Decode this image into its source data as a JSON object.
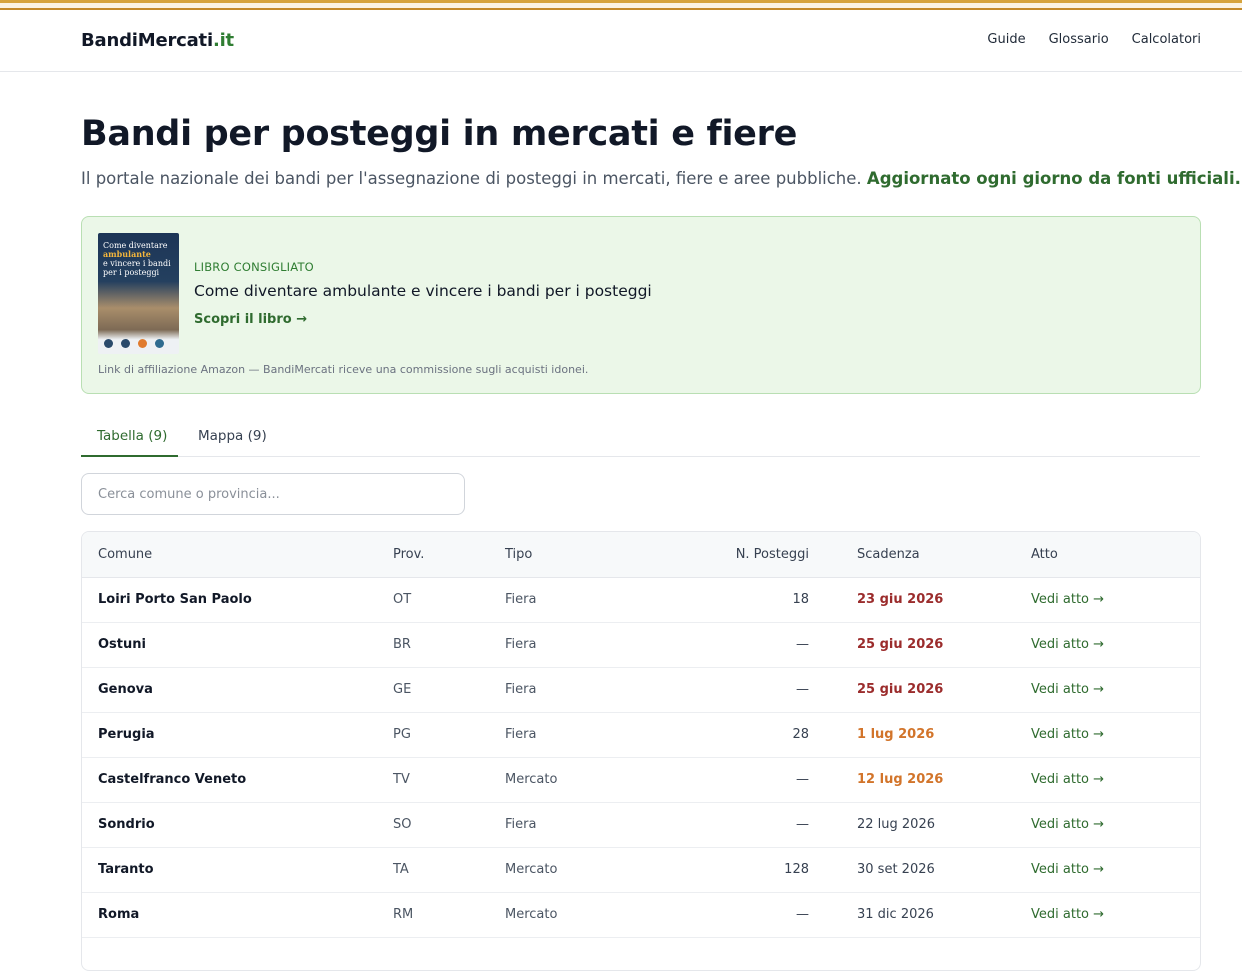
{
  "header": {
    "logo_name": "BandiMercati",
    "logo_tld": ".it",
    "nav": [
      "Guide",
      "Glossario",
      "Calcolatori"
    ]
  },
  "hero": {
    "title": "Bandi per posteggi in mercati e fiere",
    "subtitle": "Il portale nazionale dei bandi per l'assegnazione di posteggi in mercati, fiere e aree pubbliche.",
    "subtitle_highlight": "Aggiornato ogni giorno da fonti ufficiali."
  },
  "promo": {
    "cover_line1": "Come diventare",
    "cover_line2": "ambulante",
    "cover_line3": "e vincere i bandi",
    "cover_line4": "per i posteggi",
    "kicker": "LIBRO CONSIGLIATO",
    "title": "Come diventare ambulante e vincere i bandi per i posteggi",
    "link": "Scopri il libro →",
    "note": "Link di affiliazione Amazon — BandiMercati riceve una commissione sugli acquisti idonei."
  },
  "tabs": [
    {
      "label": "Tabella (9)",
      "active": true
    },
    {
      "label": "Mappa (9)",
      "active": false
    }
  ],
  "search": {
    "placeholder": "Cerca comune o provincia...",
    "value": ""
  },
  "table": {
    "headers": [
      "Comune",
      "Prov.",
      "Tipo",
      "N. Posteggi",
      "Scadenza",
      "Atto"
    ],
    "rows": [
      {
        "comune": "Loiri Porto San Paolo",
        "prov": "OT",
        "tipo": "Fiera",
        "posteggi": "18",
        "scadenza": "23 giu 2026",
        "urgency": "red",
        "atto": "Vedi atto →"
      },
      {
        "comune": "Ostuni",
        "prov": "BR",
        "tipo": "Fiera",
        "posteggi": "—",
        "scadenza": "25 giu 2026",
        "urgency": "red",
        "atto": "Vedi atto →"
      },
      {
        "comune": "Genova",
        "prov": "GE",
        "tipo": "Fiera",
        "posteggi": "—",
        "scadenza": "25 giu 2026",
        "urgency": "red",
        "atto": "Vedi atto →"
      },
      {
        "comune": "Perugia",
        "prov": "PG",
        "tipo": "Fiera",
        "posteggi": "28",
        "scadenza": "1 lug 2026",
        "urgency": "orange",
        "atto": "Vedi atto →"
      },
      {
        "comune": "Castelfranco Veneto",
        "prov": "TV",
        "tipo": "Mercato",
        "posteggi": "—",
        "scadenza": "12 lug 2026",
        "urgency": "orange",
        "atto": "Vedi atto →"
      },
      {
        "comune": "Sondrio",
        "prov": "SO",
        "tipo": "Fiera",
        "posteggi": "—",
        "scadenza": "22 lug 2026",
        "urgency": "plain",
        "atto": "Vedi atto →"
      },
      {
        "comune": "Taranto",
        "prov": "TA",
        "tipo": "Mercato",
        "posteggi": "128",
        "scadenza": "30 set 2026",
        "urgency": "plain",
        "atto": "Vedi atto →"
      },
      {
        "comune": "Roma",
        "prov": "RM",
        "tipo": "Mercato",
        "posteggi": "—",
        "scadenza": "31 dic 2026",
        "urgency": "plain",
        "atto": "Vedi atto →"
      }
    ]
  },
  "colors": {
    "brand_green": "#2f6b2f",
    "urgent_red": "#9b2c2c",
    "soon_orange": "#d2742a",
    "promo_bg": "#ebf7e8"
  }
}
